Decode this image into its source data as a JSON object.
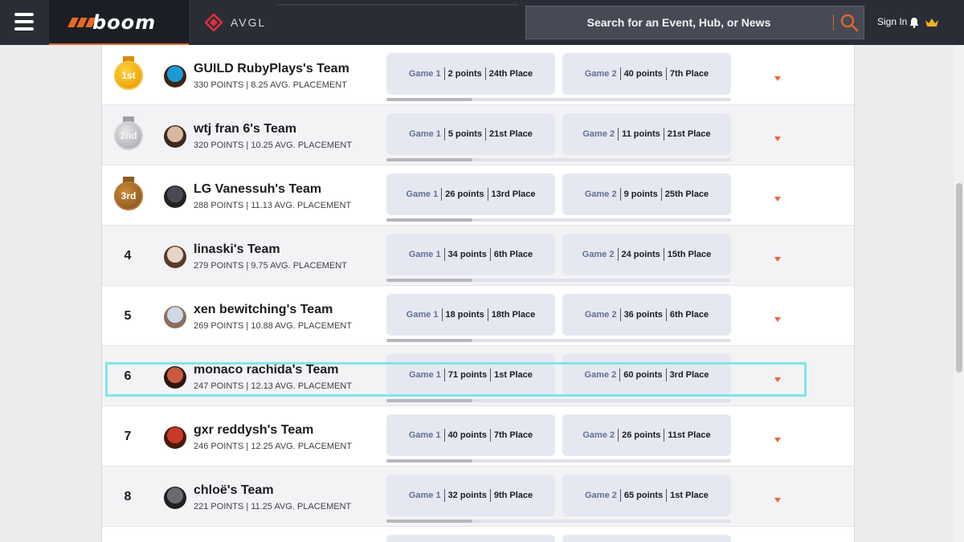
{
  "header": {
    "logo_text": "boom",
    "partner_text": "AVGL",
    "search_placeholder": "Search for an Event, Hub, or News",
    "signin_label": "Sign In"
  },
  "leaderboard": [
    {
      "rank": "1st",
      "medal": "gold",
      "team": "GUILD RubyPlays's Team",
      "stats": "330 POINTS | 8.25 AVG. PLACEMENT",
      "game1": {
        "label": "Game 1",
        "points": "2 points",
        "place": "24th Place"
      },
      "game2": {
        "label": "Game 2",
        "points": "40 points",
        "place": "7th Place"
      },
      "progress": 0.25
    },
    {
      "rank": "2nd",
      "medal": "silver",
      "team": "wtj fran 6's Team",
      "stats": "320 POINTS | 10.25 AVG. PLACEMENT",
      "game1": {
        "label": "Game 1",
        "points": "5 points",
        "place": "21st Place"
      },
      "game2": {
        "label": "Game 2",
        "points": "11 points",
        "place": "21st Place"
      },
      "progress": 0.25
    },
    {
      "rank": "3rd",
      "medal": "bronze",
      "team": "LG Vanessuh's Team",
      "stats": "288 POINTS | 11.13 AVG. PLACEMENT",
      "game1": {
        "label": "Game 1",
        "points": "26 points",
        "place": "13rd Place"
      },
      "game2": {
        "label": "Game 2",
        "points": "9 points",
        "place": "25th Place"
      },
      "progress": 0.25
    },
    {
      "rank": "4",
      "medal": "",
      "team": "linaski's Team",
      "stats": "279 POINTS | 9.75 AVG. PLACEMENT",
      "game1": {
        "label": "Game 1",
        "points": "34 points",
        "place": "6th Place"
      },
      "game2": {
        "label": "Game 2",
        "points": "24 points",
        "place": "15th Place"
      },
      "progress": 0.25
    },
    {
      "rank": "5",
      "medal": "",
      "team": "xen bewitching's Team",
      "stats": "269 POINTS | 10.88 AVG. PLACEMENT",
      "game1": {
        "label": "Game 1",
        "points": "18 points",
        "place": "18th Place"
      },
      "game2": {
        "label": "Game 2",
        "points": "36 points",
        "place": "6th Place"
      },
      "progress": 0.25
    },
    {
      "rank": "6",
      "medal": "",
      "team": "monaco rachida's Team",
      "stats": "247 POINTS | 12.13 AVG. PLACEMENT",
      "game1": {
        "label": "Game 1",
        "points": "71 points",
        "place": "1st Place"
      },
      "game2": {
        "label": "Game 2",
        "points": "60 points",
        "place": "3rd Place"
      },
      "progress": 0.25
    },
    {
      "rank": "7",
      "medal": "",
      "team": "gxr reddysh's Team",
      "stats": "246 POINTS | 12.25 AVG. PLACEMENT",
      "game1": {
        "label": "Game 1",
        "points": "40 points",
        "place": "7th Place"
      },
      "game2": {
        "label": "Game 2",
        "points": "26 points",
        "place": "11st Place"
      },
      "progress": 0.25
    },
    {
      "rank": "8",
      "medal": "",
      "team": "chloë's Team",
      "stats": "221 POINTS | 11.25 AVG. PLACEMENT",
      "game1": {
        "label": "Game 1",
        "points": "32 points",
        "place": "9th Place"
      },
      "game2": {
        "label": "Game 2",
        "points": "65 points",
        "place": "1st Place"
      },
      "progress": 0.25
    }
  ],
  "colors": {
    "accent": "#e0652a",
    "header_bg": "#2a2d36",
    "highlight": "#7fe6e8",
    "card_bg": "#e6e8f1",
    "game_label": "#5f7194"
  },
  "icons": {
    "menu": "hamburger-icon",
    "search": "search-icon",
    "notifications": "bell-icon",
    "premium": "crown-icon",
    "expand": "chevron-down-icon"
  }
}
